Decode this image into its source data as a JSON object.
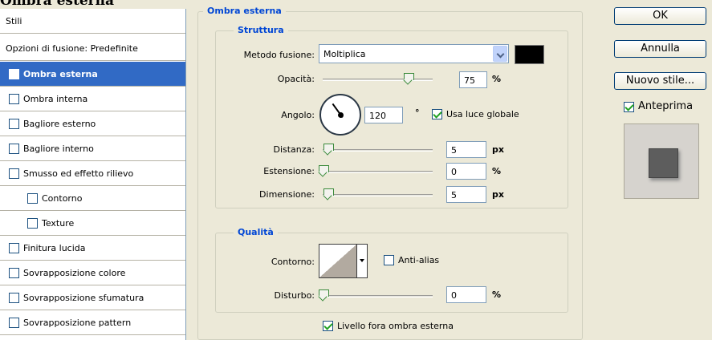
{
  "window": {
    "title": "Ombra esterna"
  },
  "left_panel": {
    "items": [
      {
        "label": "Stili",
        "has_checkbox": false,
        "checked": false,
        "selected": false,
        "indent": 0
      },
      {
        "label": "Opzioni di fusione: Predefinite",
        "has_checkbox": false,
        "checked": false,
        "selected": false,
        "indent": 0
      },
      {
        "label": "Ombra esterna",
        "has_checkbox": true,
        "checked": true,
        "selected": true,
        "indent": 0
      },
      {
        "label": "Ombra interna",
        "has_checkbox": true,
        "checked": false,
        "selected": false,
        "indent": 0
      },
      {
        "label": "Bagliore esterno",
        "has_checkbox": true,
        "checked": false,
        "selected": false,
        "indent": 0
      },
      {
        "label": "Bagliore interno",
        "has_checkbox": true,
        "checked": false,
        "selected": false,
        "indent": 0
      },
      {
        "label": "Smusso ed effetto rilievo",
        "has_checkbox": true,
        "checked": false,
        "selected": false,
        "indent": 0
      },
      {
        "label": "Contorno",
        "has_checkbox": true,
        "checked": false,
        "selected": false,
        "indent": 1
      },
      {
        "label": "Texture",
        "has_checkbox": true,
        "checked": false,
        "selected": false,
        "indent": 1
      },
      {
        "label": "Finitura lucida",
        "has_checkbox": true,
        "checked": false,
        "selected": false,
        "indent": 0
      },
      {
        "label": "Sovrapposizione colore",
        "has_checkbox": true,
        "checked": false,
        "selected": false,
        "indent": 0
      },
      {
        "label": "Sovrapposizione sfumatura",
        "has_checkbox": true,
        "checked": false,
        "selected": false,
        "indent": 0
      },
      {
        "label": "Sovrapposizione pattern",
        "has_checkbox": true,
        "checked": false,
        "selected": false,
        "indent": 0
      }
    ]
  },
  "main": {
    "group_title": "Ombra esterna",
    "struttura": {
      "title": "Struttura",
      "blend_mode_label": "Metodo fusione:",
      "blend_mode_value": "Moltiplica",
      "shadow_color": "#000000",
      "opacity_label": "Opacità:",
      "opacity_value": "75",
      "opacity_unit": "%",
      "opacity_fraction": 0.75,
      "angle_label": "Angolo:",
      "angle_value": "120",
      "angle_unit": "°",
      "global_light_label": "Usa luce globale",
      "global_light_checked": true,
      "distance_label": "Distanza:",
      "distance_value": "5",
      "distance_unit": "px",
      "spread_label": "Estensione:",
      "spread_value": "0",
      "spread_unit": "%",
      "size_label": "Dimensione:",
      "size_value": "5",
      "size_unit": "px"
    },
    "qualita": {
      "title": "Qualità",
      "contour_label": "Contorno:",
      "antialias_label": "Anti-alias",
      "antialias_checked": false,
      "noise_label": "Disturbo:",
      "noise_value": "0",
      "noise_unit": "%"
    },
    "knockout_label": "Livello fora ombra esterna",
    "knockout_checked": true
  },
  "buttons": {
    "ok": "OK",
    "cancel": "Annulla",
    "new_style": "Nuovo stile...",
    "preview_label": "Anteprima",
    "preview_checked": true
  },
  "colors": {
    "selection": "#316ac5",
    "group_title": "#0046d5",
    "background": "#ece9d8"
  }
}
